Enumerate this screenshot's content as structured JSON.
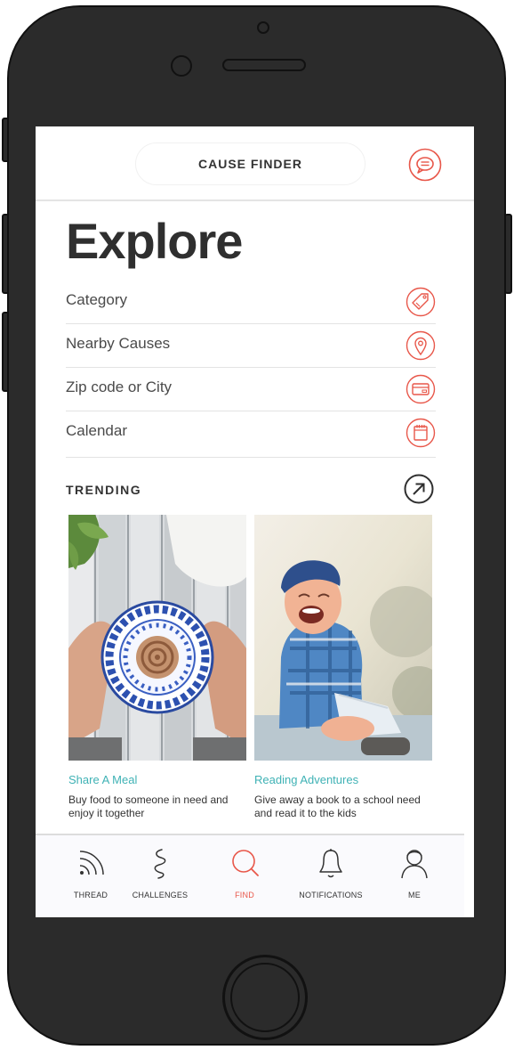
{
  "colors": {
    "accent": "#e8574a",
    "teal": "#3fb2b5",
    "text_dark": "#2f2f2f",
    "phone_body": "#2b2b2b"
  },
  "header": {
    "title": "CAUSE FINDER",
    "chat_icon": "chat-bubble-icon"
  },
  "page": {
    "title": "Explore"
  },
  "menu": [
    {
      "label": "Category",
      "icon": "tag-icon"
    },
    {
      "label": "Nearby Causes",
      "icon": "location-pin-icon"
    },
    {
      "label": "Zip code or City",
      "icon": "card-icon"
    },
    {
      "label": "Calendar",
      "icon": "calendar-icon"
    }
  ],
  "trending": {
    "label": "TRENDING",
    "arrow_icon": "arrow-up-right-icon",
    "cards": [
      {
        "title": "Share A Meal",
        "description": "Buy food to someone in need and enjoy it together"
      },
      {
        "title": "Reading Adventures",
        "description": "Give away a book to a school need and read it to the kids"
      }
    ]
  },
  "tabs": [
    {
      "label": "THREAD",
      "icon": "rss-icon",
      "active": false
    },
    {
      "label": "CHALLENGES",
      "icon": "squiggle-icon",
      "active": false
    },
    {
      "label": "FIND",
      "icon": "search-icon",
      "active": true
    },
    {
      "label": "NOTIFICATIONS",
      "icon": "bell-icon",
      "active": false
    },
    {
      "label": "ME",
      "icon": "user-icon",
      "active": false
    }
  ]
}
